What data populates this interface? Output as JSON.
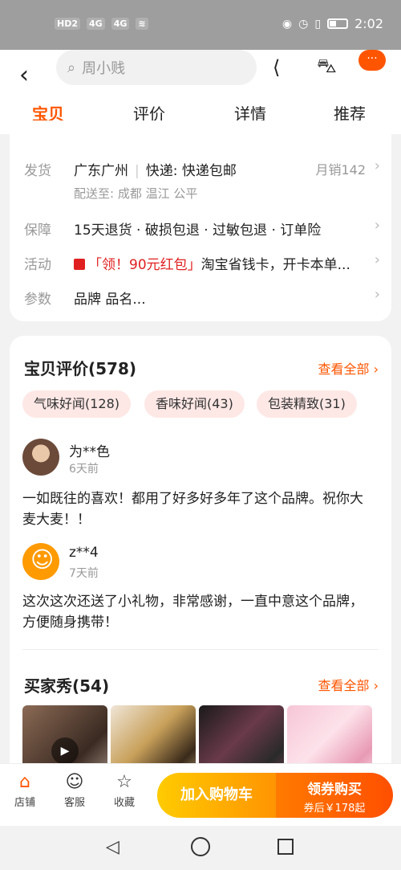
{
  "status": {
    "left_badges": [
      "HD2",
      "4G",
      "4G",
      "WiFi"
    ],
    "time": "2:02"
  },
  "header": {
    "back_icon": "chevron-left-icon",
    "search_placeholder": "周小贱",
    "share_icon": "share-icon",
    "cart_icon": "cart-icon",
    "more_label": "···"
  },
  "tabs": [
    {
      "label": "宝贝"
    },
    {
      "label": "评价"
    },
    {
      "label": "详情"
    },
    {
      "label": "推荐"
    }
  ],
  "info": {
    "ship_label": "发货",
    "ship_location": "广东广州",
    "ship_express": "快递: 快递包邮",
    "monthly_sales": "月销142",
    "ship_to": "配送至: 成都 温江 公平",
    "guarantee_label": "保障",
    "guarantee_text": "15天退货 · 破损包退 · 过敏包退 · 订单险",
    "activity_label": "活动",
    "activity_tag": "「领！90元红包」",
    "activity_text": "淘宝省钱卡，开卡本单...",
    "params_label": "参数",
    "params_text": "品牌 品名..."
  },
  "reviews": {
    "title": "宝贝评价(578)",
    "see_all": "查看全部",
    "tags": [
      {
        "label": "气味好闻(128)"
      },
      {
        "label": "香味好闻(43)"
      },
      {
        "label": "包装精致(31)"
      }
    ],
    "items": [
      {
        "user": "为**色",
        "time": "6天前",
        "text": "一如既往的喜欢！都用了好多好多年了这个品牌。祝你大麦大麦！！"
      },
      {
        "user": "z**4",
        "time": "7天前",
        "text": "这次这次还送了小礼物，非常感谢，一直中意这个品牌，方便随身携带！"
      }
    ]
  },
  "buyer_show": {
    "title": "买家秀(54)",
    "see_all": "查看全部"
  },
  "bottom": {
    "store_label": "店铺",
    "service_label": "客服",
    "favorite_label": "收藏",
    "add_cart": "加入购物车",
    "buy_label": "领券购买",
    "buy_sub": "券后￥178起"
  }
}
